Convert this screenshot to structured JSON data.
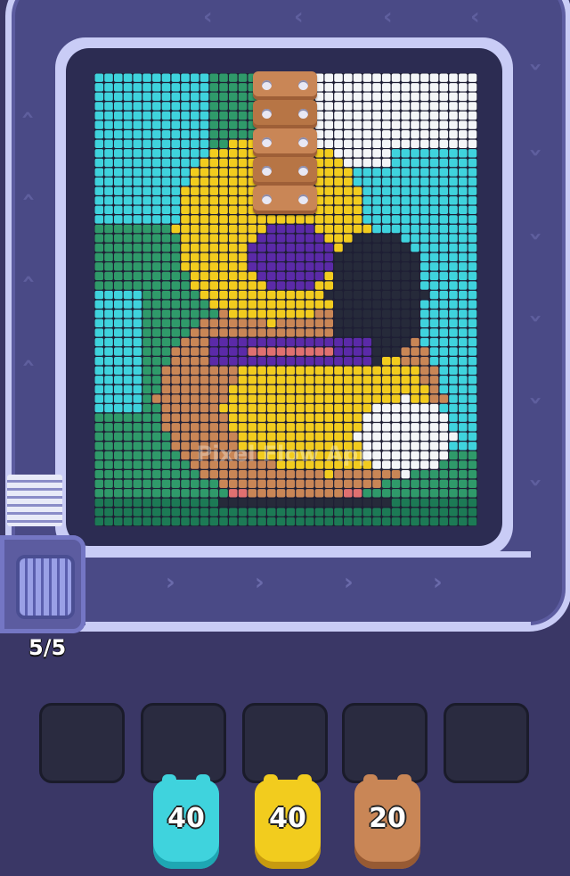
{
  "counter": "5/5",
  "watermark": "Pixel Flow App",
  "colors": {
    "background": "#3a3766",
    "track": "#c9ccf6",
    "cyan": "#3fd3dd",
    "yellow": "#f2cc1e",
    "brown": "#c98656"
  },
  "slots": [
    {
      "id": 1,
      "state": "empty"
    },
    {
      "id": 2,
      "state": "empty"
    },
    {
      "id": 3,
      "state": "empty"
    },
    {
      "id": 4,
      "state": "empty"
    },
    {
      "id": 5,
      "state": "empty"
    }
  ],
  "shooters": [
    {
      "color": "cyan",
      "count": "40"
    },
    {
      "color": "yellow",
      "count": "40"
    },
    {
      "color": "brown",
      "count": "20"
    }
  ],
  "pegs": 5
}
